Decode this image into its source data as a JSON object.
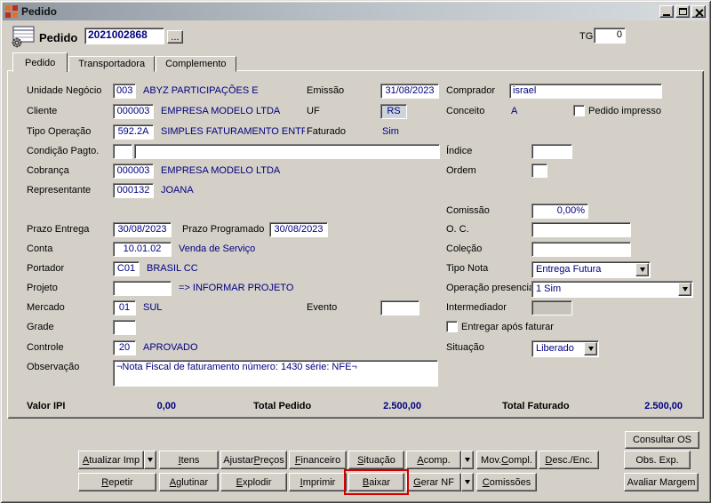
{
  "window": {
    "title": "Pedido"
  },
  "header": {
    "label": "Pedido",
    "order_number": "2021002868",
    "ellipsis_label": "...",
    "tg_label": "TG",
    "tg_value": "0"
  },
  "tabs": [
    {
      "label": "Pedido"
    },
    {
      "label": "Transportadora"
    },
    {
      "label": "Complemento"
    }
  ],
  "form": {
    "unidade_negocio": {
      "label": "Unidade Negócio",
      "code": "003",
      "desc": "ABYZ PARTICIPAÇÕES E"
    },
    "emissao": {
      "label": "Emissão",
      "value": "31/08/2023"
    },
    "comprador": {
      "label": "Comprador",
      "value": "israel"
    },
    "cliente": {
      "label": "Cliente",
      "code": "000003",
      "desc": "EMPRESA MODELO LTDA"
    },
    "uf": {
      "label": "UF",
      "value": "RS"
    },
    "conceito": {
      "label": "Conceito",
      "value": "A"
    },
    "pedido_impresso": {
      "label": "Pedido impresso",
      "checked": false
    },
    "tipo_operacao": {
      "label": "Tipo Operação",
      "code": "592.2A",
      "desc": "SIMPLES FATURAMENTO  ENTREGA FUTUR"
    },
    "faturado": {
      "label": "Faturado",
      "value": "Sim"
    },
    "condicao_pagto": {
      "label": "Condição Pagto.",
      "code": "",
      "desc": ""
    },
    "indice": {
      "label": "Índice",
      "value": ""
    },
    "cobranca": {
      "label": "Cobrança",
      "code": "000003",
      "desc": "EMPRESA MODELO LTDA"
    },
    "ordem": {
      "label": "Ordem",
      "value": ""
    },
    "representante": {
      "label": "Representante",
      "code": "000132",
      "desc": "JOANA"
    },
    "comissao": {
      "label": "Comissão",
      "value": "0,00%"
    },
    "prazo_entrega": {
      "label": "Prazo Entrega",
      "value": "30/08/2023"
    },
    "prazo_programado": {
      "label": "Prazo Programado",
      "value": "30/08/2023"
    },
    "oc": {
      "label": "O. C.",
      "value": ""
    },
    "conta": {
      "label": "Conta",
      "code": "10.01.02",
      "desc": "Venda de Serviço"
    },
    "colecao": {
      "label": "Coleção",
      "value": ""
    },
    "portador": {
      "label": "Portador",
      "code": "C01",
      "desc": "BRASIL CC"
    },
    "tipo_nota": {
      "label": "Tipo Nota",
      "value": "Entrega Futura"
    },
    "projeto": {
      "label": "Projeto",
      "value": "",
      "hint": "=> INFORMAR PROJETO"
    },
    "operacao_presencial": {
      "label": "Operação presencial",
      "value": "1 Sim"
    },
    "mercado": {
      "label": "Mercado",
      "code": "01",
      "desc": "SUL"
    },
    "evento": {
      "label": "Evento",
      "value": ""
    },
    "intermediador": {
      "label": "Intermediador",
      "value": ""
    },
    "grade": {
      "label": "Grade",
      "value": ""
    },
    "entregar_apos_faturar": {
      "label": "Entregar após faturar",
      "checked": false
    },
    "controle": {
      "label": "Controle",
      "code": "20",
      "desc": "APROVADO"
    },
    "situacao": {
      "label": "Situação",
      "value": "Liberado"
    },
    "observacao": {
      "label": "Observação",
      "value": "¬Nota Fiscal de faturamento número: 1430 série: NFE¬"
    }
  },
  "totals": {
    "valor_ipi_label": "Valor IPI",
    "valor_ipi": "0,00",
    "total_pedido_label": "Total Pedido",
    "total_pedido": "2.500,00",
    "total_faturado_label": "Total Faturado",
    "total_faturado": "2.500,00"
  },
  "buttons": {
    "consultar_os": "Consultar OS",
    "row1": [
      "Atualizar Imp",
      "Itens",
      "Ajustar Preços",
      "Financeiro",
      "Situação",
      "Acomp.",
      "Mov.Compl.",
      "Desc./Enc.",
      "Obs. Exp."
    ],
    "row2": [
      "Repetir",
      "Aglutinar",
      "Explodir",
      "Imprimir",
      "Baixar",
      "Gerar NF",
      "Comissões",
      "Avaliar Margem"
    ]
  },
  "colors": {
    "value_text": "#000080",
    "window_bg": "#d4d0c8",
    "highlight": "#d40000"
  },
  "icons": {
    "app": "orange-grid",
    "order": "order-form-gear",
    "dropdown": "triangle-down",
    "minimize": "bar",
    "maximize": "square",
    "close": "cross"
  }
}
